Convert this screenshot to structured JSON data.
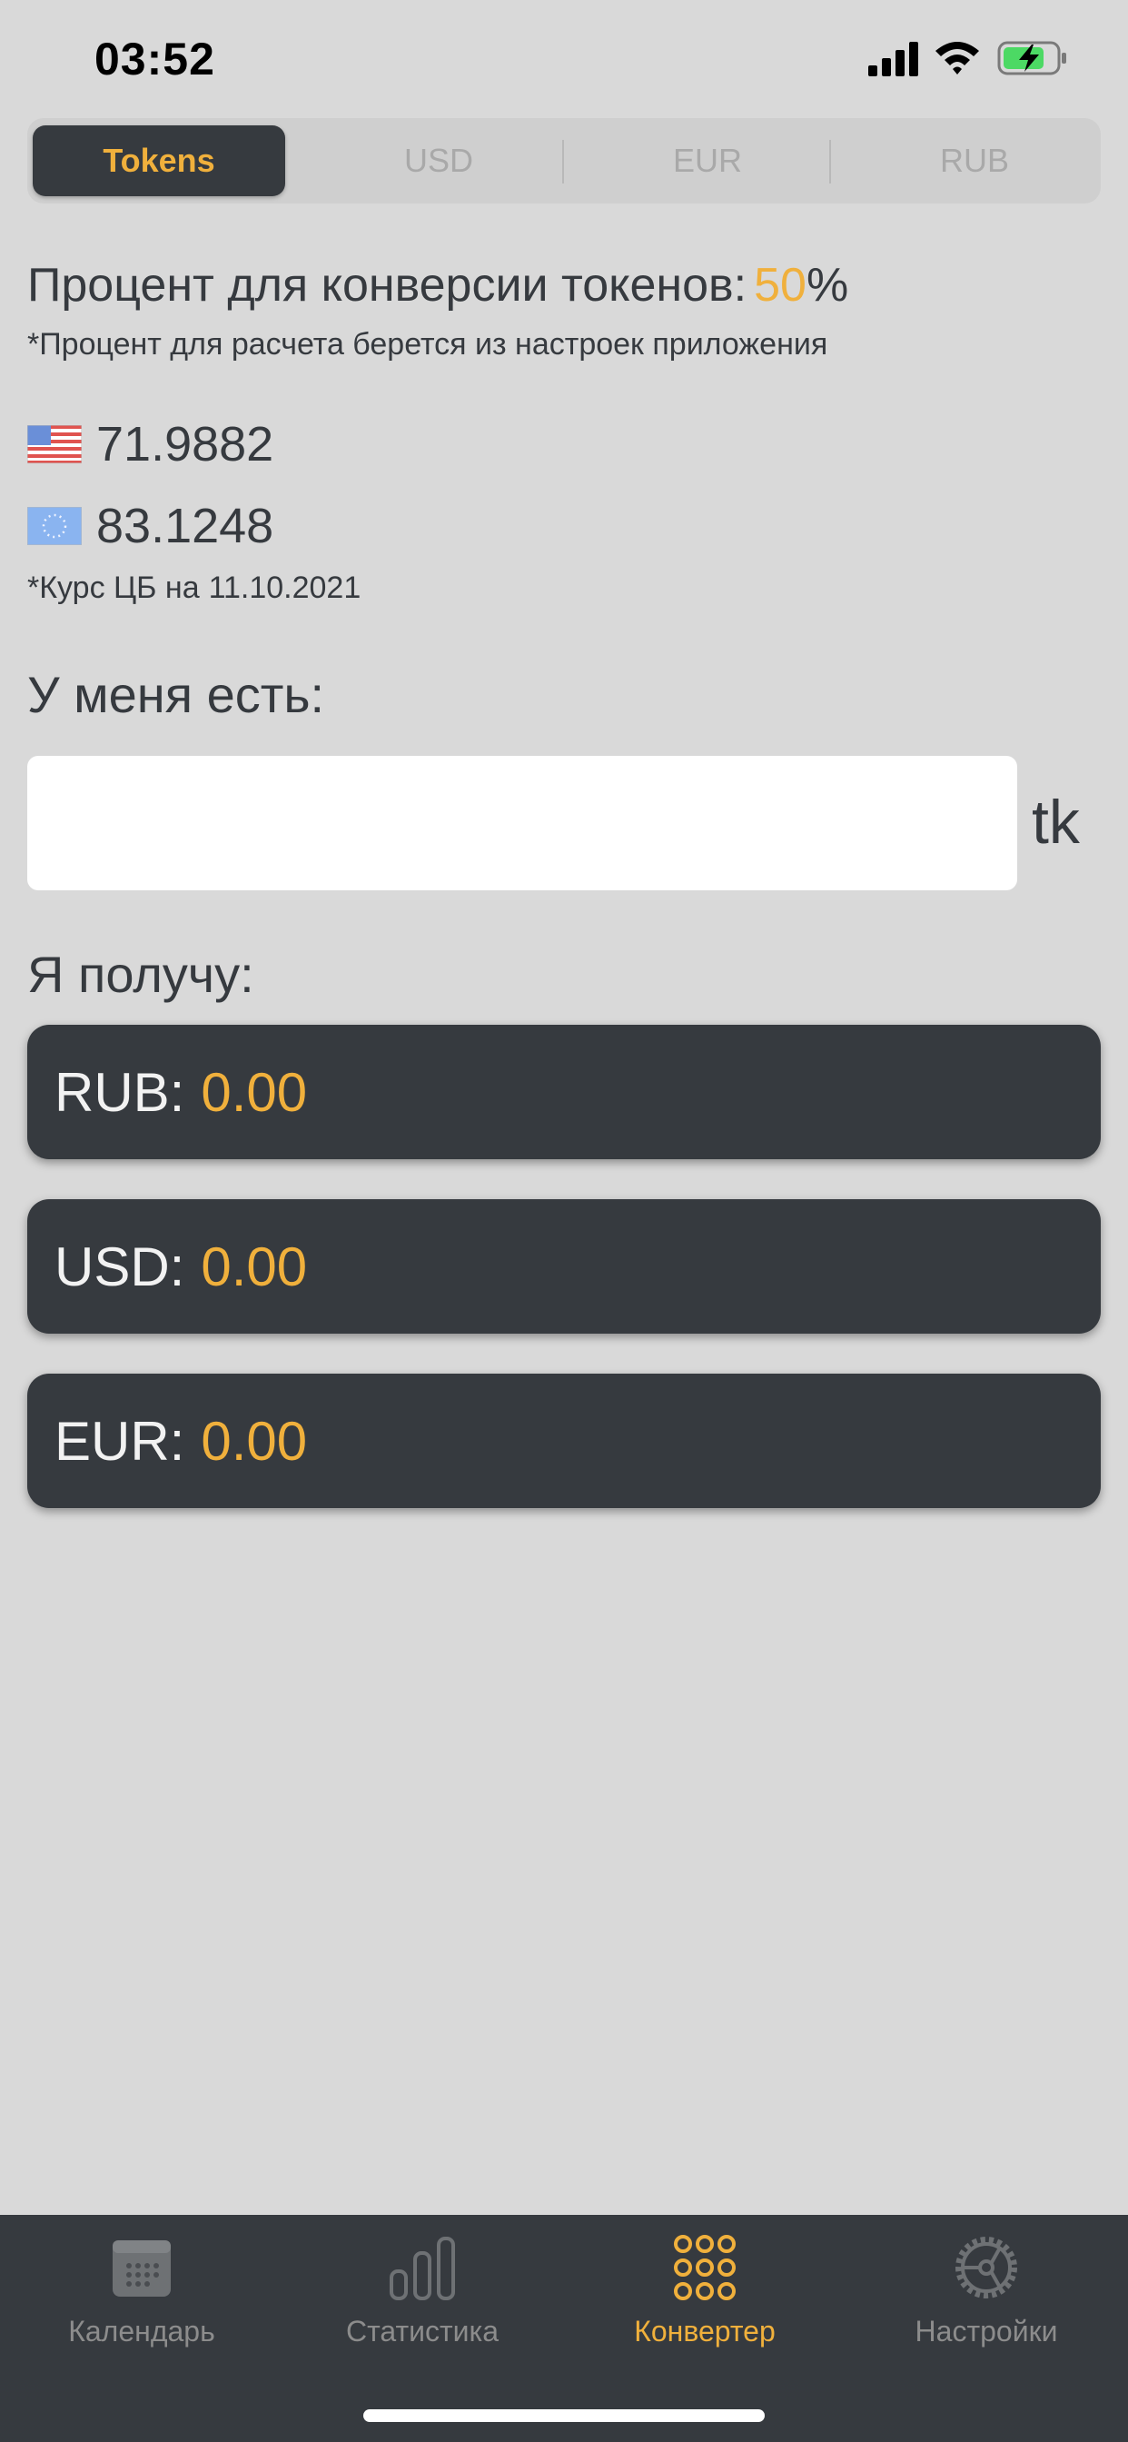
{
  "status": {
    "time": "03:52"
  },
  "segments": [
    {
      "label": "Tokens",
      "active": true
    },
    {
      "label": "USD",
      "active": false
    },
    {
      "label": "EUR",
      "active": false
    },
    {
      "label": "RUB",
      "active": false
    }
  ],
  "percent": {
    "label": "Процент для конверсии токенов:",
    "value": "50",
    "suffix": "%",
    "note": "*Процент для расчета берется из настроек приложения"
  },
  "rates": {
    "usd": {
      "value": "71.9882",
      "icon": "us-flag-icon"
    },
    "eur": {
      "value": "83.1248",
      "icon": "eu-flag-icon"
    },
    "note_label": "*Курс ЦБ на",
    "note_date": "11.10.2021"
  },
  "input": {
    "label": "У меня есть:",
    "value": "",
    "unit": "tk"
  },
  "output": {
    "label": "Я получу:",
    "rows": [
      {
        "currency": "RUB:",
        "amount": "0.00"
      },
      {
        "currency": "USD:",
        "amount": "0.00"
      },
      {
        "currency": "EUR:",
        "amount": "0.00"
      }
    ]
  },
  "tabbar": [
    {
      "label": "Календарь",
      "icon": "calendar-icon",
      "active": false
    },
    {
      "label": "Статистика",
      "icon": "bar-chart-icon",
      "active": false
    },
    {
      "label": "Конвертер",
      "icon": "grid-dots-icon",
      "active": true
    },
    {
      "label": "Настройки",
      "icon": "gear-icon",
      "active": false
    }
  ],
  "colors": {
    "accent": "#f0b03c",
    "dark": "#363a3f",
    "background": "#d9d9d9"
  }
}
